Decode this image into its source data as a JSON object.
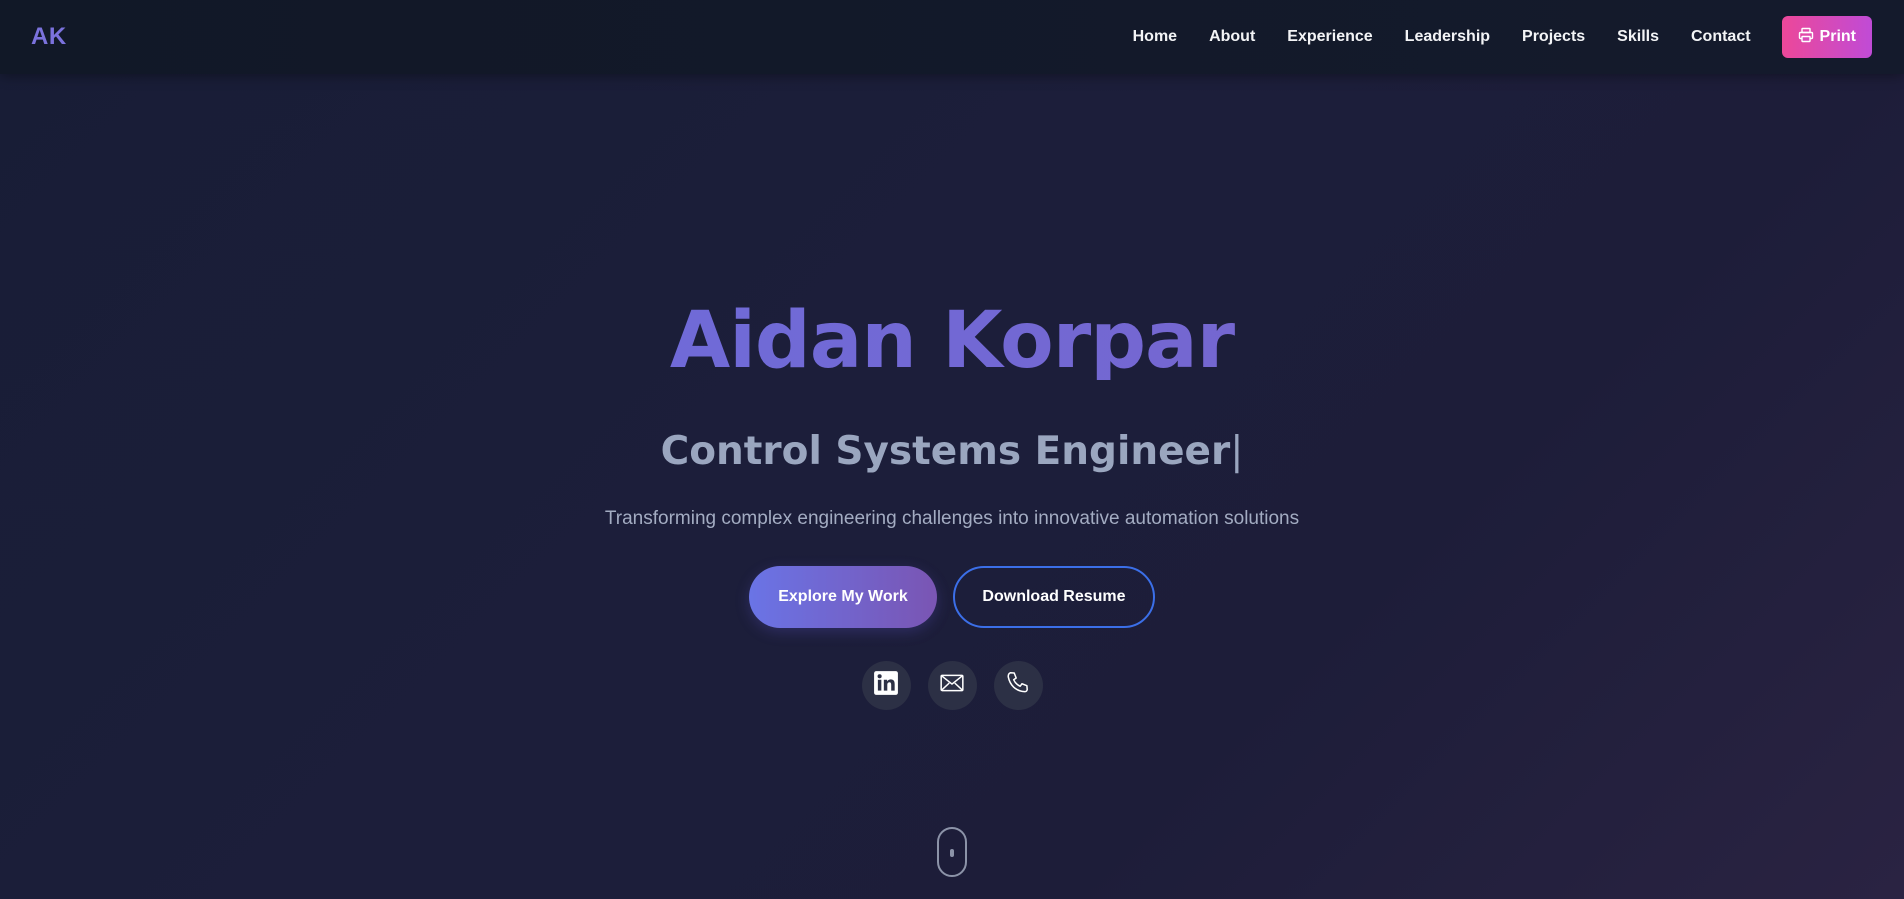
{
  "nav": {
    "logo": "AK",
    "links": [
      "Home",
      "About",
      "Experience",
      "Leadership",
      "Projects",
      "Skills",
      "Contact"
    ],
    "print_label": "Print"
  },
  "hero": {
    "name": "Aidan Korpar",
    "role": "Control Systems Engineer",
    "cursor": "|",
    "tagline": "Transforming complex engineering challenges into innovative automation solutions",
    "primary_button": "Explore My Work",
    "secondary_button": "Download Resume",
    "social_icons": [
      "linkedin-icon",
      "mail-icon",
      "phone-icon"
    ]
  },
  "colors": {
    "accent": "#6a6fe0",
    "print_button": "#ec4899",
    "outline_button_border": "#3b6fe8",
    "background": "#1a1c35"
  }
}
